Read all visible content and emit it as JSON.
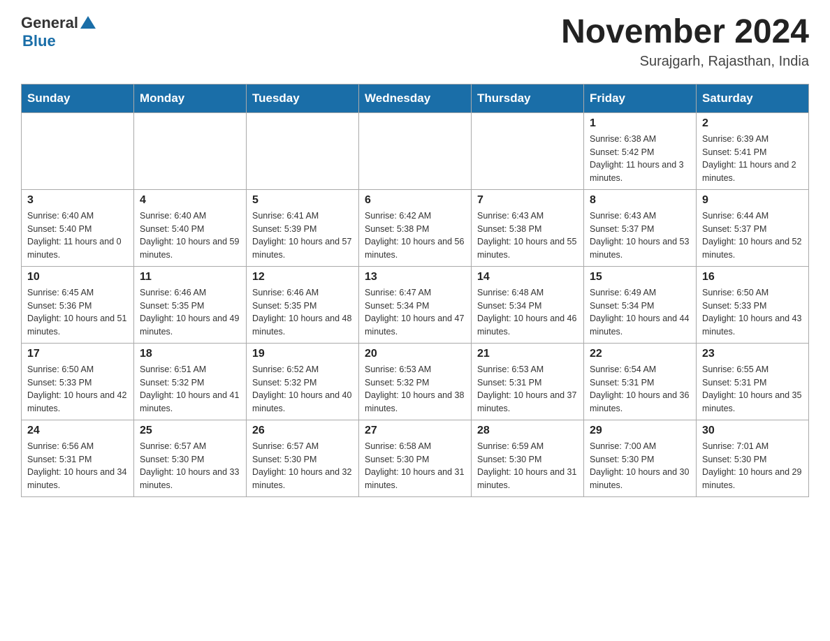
{
  "header": {
    "logo": {
      "general_text": "General",
      "blue_text": "Blue"
    },
    "title": "November 2024",
    "location": "Surajgarh, Rajasthan, India"
  },
  "weekdays": [
    "Sunday",
    "Monday",
    "Tuesday",
    "Wednesday",
    "Thursday",
    "Friday",
    "Saturday"
  ],
  "weeks": [
    [
      {
        "day": "",
        "info": ""
      },
      {
        "day": "",
        "info": ""
      },
      {
        "day": "",
        "info": ""
      },
      {
        "day": "",
        "info": ""
      },
      {
        "day": "",
        "info": ""
      },
      {
        "day": "1",
        "info": "Sunrise: 6:38 AM\nSunset: 5:42 PM\nDaylight: 11 hours and 3 minutes."
      },
      {
        "day": "2",
        "info": "Sunrise: 6:39 AM\nSunset: 5:41 PM\nDaylight: 11 hours and 2 minutes."
      }
    ],
    [
      {
        "day": "3",
        "info": "Sunrise: 6:40 AM\nSunset: 5:40 PM\nDaylight: 11 hours and 0 minutes."
      },
      {
        "day": "4",
        "info": "Sunrise: 6:40 AM\nSunset: 5:40 PM\nDaylight: 10 hours and 59 minutes."
      },
      {
        "day": "5",
        "info": "Sunrise: 6:41 AM\nSunset: 5:39 PM\nDaylight: 10 hours and 57 minutes."
      },
      {
        "day": "6",
        "info": "Sunrise: 6:42 AM\nSunset: 5:38 PM\nDaylight: 10 hours and 56 minutes."
      },
      {
        "day": "7",
        "info": "Sunrise: 6:43 AM\nSunset: 5:38 PM\nDaylight: 10 hours and 55 minutes."
      },
      {
        "day": "8",
        "info": "Sunrise: 6:43 AM\nSunset: 5:37 PM\nDaylight: 10 hours and 53 minutes."
      },
      {
        "day": "9",
        "info": "Sunrise: 6:44 AM\nSunset: 5:37 PM\nDaylight: 10 hours and 52 minutes."
      }
    ],
    [
      {
        "day": "10",
        "info": "Sunrise: 6:45 AM\nSunset: 5:36 PM\nDaylight: 10 hours and 51 minutes."
      },
      {
        "day": "11",
        "info": "Sunrise: 6:46 AM\nSunset: 5:35 PM\nDaylight: 10 hours and 49 minutes."
      },
      {
        "day": "12",
        "info": "Sunrise: 6:46 AM\nSunset: 5:35 PM\nDaylight: 10 hours and 48 minutes."
      },
      {
        "day": "13",
        "info": "Sunrise: 6:47 AM\nSunset: 5:34 PM\nDaylight: 10 hours and 47 minutes."
      },
      {
        "day": "14",
        "info": "Sunrise: 6:48 AM\nSunset: 5:34 PM\nDaylight: 10 hours and 46 minutes."
      },
      {
        "day": "15",
        "info": "Sunrise: 6:49 AM\nSunset: 5:34 PM\nDaylight: 10 hours and 44 minutes."
      },
      {
        "day": "16",
        "info": "Sunrise: 6:50 AM\nSunset: 5:33 PM\nDaylight: 10 hours and 43 minutes."
      }
    ],
    [
      {
        "day": "17",
        "info": "Sunrise: 6:50 AM\nSunset: 5:33 PM\nDaylight: 10 hours and 42 minutes."
      },
      {
        "day": "18",
        "info": "Sunrise: 6:51 AM\nSunset: 5:32 PM\nDaylight: 10 hours and 41 minutes."
      },
      {
        "day": "19",
        "info": "Sunrise: 6:52 AM\nSunset: 5:32 PM\nDaylight: 10 hours and 40 minutes."
      },
      {
        "day": "20",
        "info": "Sunrise: 6:53 AM\nSunset: 5:32 PM\nDaylight: 10 hours and 38 minutes."
      },
      {
        "day": "21",
        "info": "Sunrise: 6:53 AM\nSunset: 5:31 PM\nDaylight: 10 hours and 37 minutes."
      },
      {
        "day": "22",
        "info": "Sunrise: 6:54 AM\nSunset: 5:31 PM\nDaylight: 10 hours and 36 minutes."
      },
      {
        "day": "23",
        "info": "Sunrise: 6:55 AM\nSunset: 5:31 PM\nDaylight: 10 hours and 35 minutes."
      }
    ],
    [
      {
        "day": "24",
        "info": "Sunrise: 6:56 AM\nSunset: 5:31 PM\nDaylight: 10 hours and 34 minutes."
      },
      {
        "day": "25",
        "info": "Sunrise: 6:57 AM\nSunset: 5:30 PM\nDaylight: 10 hours and 33 minutes."
      },
      {
        "day": "26",
        "info": "Sunrise: 6:57 AM\nSunset: 5:30 PM\nDaylight: 10 hours and 32 minutes."
      },
      {
        "day": "27",
        "info": "Sunrise: 6:58 AM\nSunset: 5:30 PM\nDaylight: 10 hours and 31 minutes."
      },
      {
        "day": "28",
        "info": "Sunrise: 6:59 AM\nSunset: 5:30 PM\nDaylight: 10 hours and 31 minutes."
      },
      {
        "day": "29",
        "info": "Sunrise: 7:00 AM\nSunset: 5:30 PM\nDaylight: 10 hours and 30 minutes."
      },
      {
        "day": "30",
        "info": "Sunrise: 7:01 AM\nSunset: 5:30 PM\nDaylight: 10 hours and 29 minutes."
      }
    ]
  ]
}
